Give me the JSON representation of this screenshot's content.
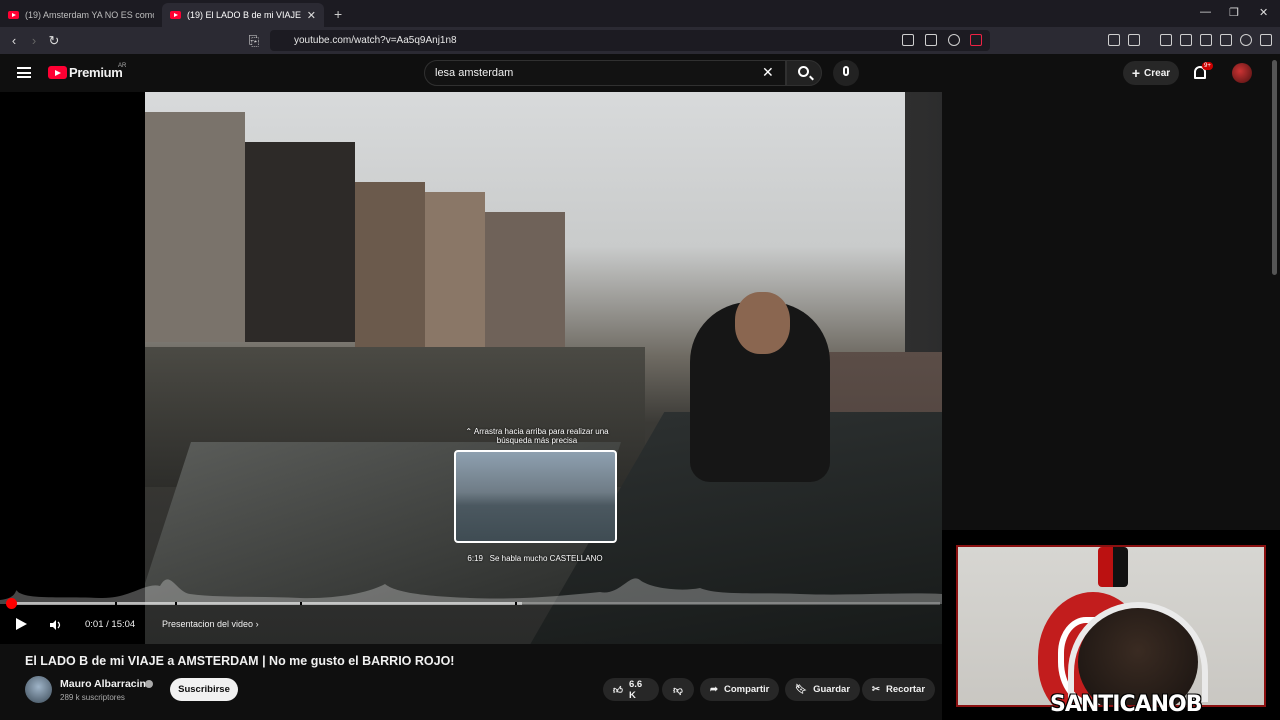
{
  "browser": {
    "tabs": [
      {
        "title": "(19) Amsterdam YA NO ES como ante",
        "active": false
      },
      {
        "title": "(19) El LADO B de mi VIAJE a AMS",
        "active": true
      }
    ],
    "url": "youtube.com/watch?v=Aa5q9Anj1n8"
  },
  "masthead": {
    "logo_text": "Premium",
    "region": "AR",
    "search_value": "lesa amsterdam",
    "create_label": "Crear",
    "notifications": "9+"
  },
  "player": {
    "drag_hint": "⌃ Arrastra hacia arriba para realizar una búsqueda más precisa",
    "preview_time": "6:19",
    "preview_chapter": "Se habla mucho CASTELLANO",
    "time_display": "0:01 / 15:04",
    "chapter_label": "Presentacion del video",
    "played_fraction": 0.001,
    "buffered_fraction": 0.55
  },
  "video": {
    "title": "El LADO B de mi VIAJE a AMSTERDAM | No me gusto el BARRIO ROJO!",
    "channel": "Mauro Albarracin",
    "subscribers": "289 k suscriptores",
    "subscribe_label": "Suscribirse",
    "likes": "6.6 K",
    "share_label": "Compartir",
    "save_label": "Guardar",
    "clip_label": "Recortar"
  },
  "overlay": {
    "streamer": "SANTICANOB"
  },
  "colors": {
    "youtube_red": "#ff0033",
    "progress_red": "#ff0000",
    "background": "#0f0f0f"
  }
}
